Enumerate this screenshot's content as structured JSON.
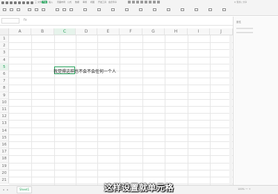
{
  "ribbon": {
    "tabs": [
      {
        "label": "三 文件",
        "active": false
      },
      {
        "label": "开始",
        "active": true
      },
      {
        "label": "插入",
        "active": false
      },
      {
        "label": "页面布局",
        "active": false
      },
      {
        "label": "公式",
        "active": false
      },
      {
        "label": "数据",
        "active": false
      },
      {
        "label": "审阅",
        "active": false
      },
      {
        "label": "视图",
        "active": false
      },
      {
        "label": "开发工具",
        "active": false
      },
      {
        "label": "会员专享",
        "active": false
      }
    ],
    "right_label": "Q 查找 | 分享"
  },
  "formula_bar": {
    "fx": "fx"
  },
  "columns": [
    "A",
    "B",
    "C",
    "D",
    "E",
    "F",
    "G",
    "H",
    "I",
    "J"
  ],
  "selected_column": "C",
  "rows": [
    "1",
    "2",
    "3",
    "4",
    "5",
    "6",
    "7",
    "8",
    "9",
    "10",
    "11",
    "12",
    "13",
    "14",
    "15",
    "16",
    "17",
    "18",
    "19",
    "20",
    "21"
  ],
  "selected_row": "5",
  "cell_text": "我觉得这样也不会不会任何一个人",
  "right_pane": {
    "title": "属性"
  },
  "sheet": {
    "tab": "Sheet1",
    "status": "100% 一 +"
  },
  "subtitle": "这样设置就单元格"
}
